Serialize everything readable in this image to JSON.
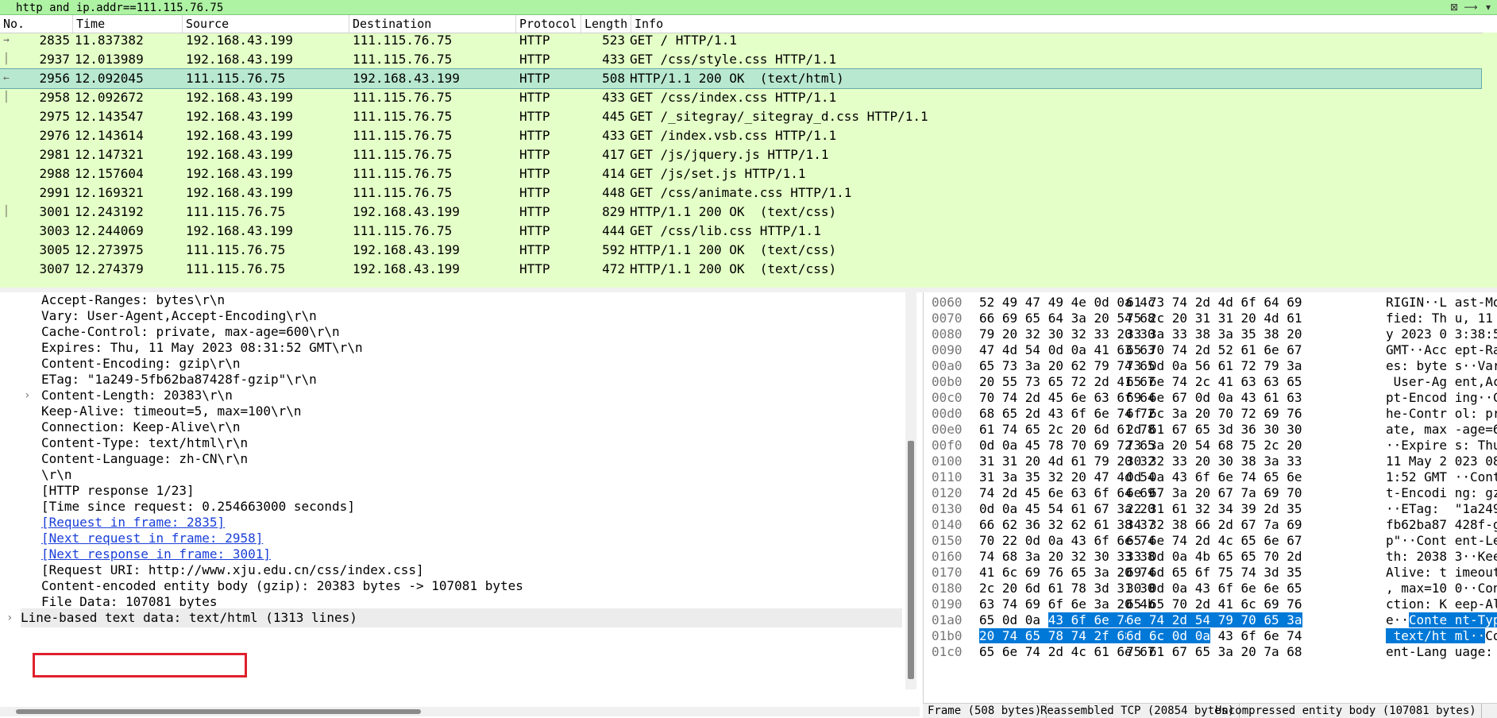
{
  "filter": {
    "value": "http and ip.addr==111.115.76.75",
    "clear_glyph": "⊠",
    "apply_glyph": "⟶",
    "dropdown_glyph": "▾"
  },
  "packet_list": {
    "columns": [
      "No.",
      "Time",
      "Source",
      "Destination",
      "Protocol",
      "Length",
      "Info"
    ],
    "rows": [
      {
        "rel": "→",
        "no": "2835",
        "time": "11.837382",
        "src": "192.168.43.199",
        "dst": "111.115.76.75",
        "proto": "HTTP",
        "len": "523",
        "info": "GET / HTTP/1.1",
        "selected": false
      },
      {
        "rel": "│",
        "no": "2937",
        "time": "12.013989",
        "src": "192.168.43.199",
        "dst": "111.115.76.75",
        "proto": "HTTP",
        "len": "433",
        "info": "GET /css/style.css HTTP/1.1",
        "selected": false
      },
      {
        "rel": "←",
        "no": "2956",
        "time": "12.092045",
        "src": "111.115.76.75",
        "dst": "192.168.43.199",
        "proto": "HTTP",
        "len": "508",
        "info": "HTTP/1.1 200 OK  (text/html)",
        "selected": true
      },
      {
        "rel": "│",
        "no": "2958",
        "time": "12.092672",
        "src": "192.168.43.199",
        "dst": "111.115.76.75",
        "proto": "HTTP",
        "len": "433",
        "info": "GET /css/index.css HTTP/1.1",
        "selected": false
      },
      {
        "rel": "",
        "no": "2975",
        "time": "12.143547",
        "src": "192.168.43.199",
        "dst": "111.115.76.75",
        "proto": "HTTP",
        "len": "445",
        "info": "GET /_sitegray/_sitegray_d.css HTTP/1.1",
        "selected": false
      },
      {
        "rel": "",
        "no": "2976",
        "time": "12.143614",
        "src": "192.168.43.199",
        "dst": "111.115.76.75",
        "proto": "HTTP",
        "len": "433",
        "info": "GET /index.vsb.css HTTP/1.1",
        "selected": false
      },
      {
        "rel": "",
        "no": "2981",
        "time": "12.147321",
        "src": "192.168.43.199",
        "dst": "111.115.76.75",
        "proto": "HTTP",
        "len": "417",
        "info": "GET /js/jquery.js HTTP/1.1",
        "selected": false
      },
      {
        "rel": "",
        "no": "2988",
        "time": "12.157604",
        "src": "192.168.43.199",
        "dst": "111.115.76.75",
        "proto": "HTTP",
        "len": "414",
        "info": "GET /js/set.js HTTP/1.1",
        "selected": false
      },
      {
        "rel": "",
        "no": "2991",
        "time": "12.169321",
        "src": "192.168.43.199",
        "dst": "111.115.76.75",
        "proto": "HTTP",
        "len": "448",
        "info": "GET /css/animate.css HTTP/1.1",
        "selected": false
      },
      {
        "rel": "│",
        "no": "3001",
        "time": "12.243192",
        "src": "111.115.76.75",
        "dst": "192.168.43.199",
        "proto": "HTTP",
        "len": "829",
        "info": "HTTP/1.1 200 OK  (text/css)",
        "selected": false
      },
      {
        "rel": "",
        "no": "3003",
        "time": "12.244069",
        "src": "192.168.43.199",
        "dst": "111.115.76.75",
        "proto": "HTTP",
        "len": "444",
        "info": "GET /css/lib.css HTTP/1.1",
        "selected": false
      },
      {
        "rel": "",
        "no": "3005",
        "time": "12.273975",
        "src": "111.115.76.75",
        "dst": "192.168.43.199",
        "proto": "HTTP",
        "len": "592",
        "info": "HTTP/1.1 200 OK  (text/css)",
        "selected": false
      },
      {
        "rel": "",
        "no": "3007",
        "time": "12.274379",
        "src": "111.115.76.75",
        "dst": "192.168.43.199",
        "proto": "HTTP",
        "len": "472",
        "info": "HTTP/1.1 200 OK  (text/css)",
        "selected": false
      }
    ]
  },
  "details": {
    "lines": [
      {
        "text": "Accept-Ranges: bytes\\r\\n",
        "link": false
      },
      {
        "text": "Vary: User-Agent,Accept-Encoding\\r\\n",
        "link": false
      },
      {
        "text": "Cache-Control: private, max-age=600\\r\\n",
        "link": false
      },
      {
        "text": "Expires: Thu, 11 May 2023 08:31:52 GMT\\r\\n",
        "link": false
      },
      {
        "text": "Content-Encoding: gzip\\r\\n",
        "link": false
      },
      {
        "text": "ETag: \"1a249-5fb62ba87428f-gzip\"\\r\\n",
        "link": false
      },
      {
        "text": "Content-Length: 20383\\r\\n",
        "link": false,
        "expander": "›"
      },
      {
        "text": "Keep-Alive: timeout=5, max=100\\r\\n",
        "link": false
      },
      {
        "text": "Connection: Keep-Alive\\r\\n",
        "link": false
      },
      {
        "text": "Content-Type: text/html\\r\\n",
        "link": false
      },
      {
        "text": "Content-Language: zh-CN\\r\\n",
        "link": false
      },
      {
        "text": "\\r\\n",
        "link": false
      },
      {
        "text": "[HTTP response 1/23]",
        "link": false
      },
      {
        "text": "[Time since request: 0.254663000 seconds]",
        "link": false
      },
      {
        "text": "[Request in frame: 2835]",
        "link": true
      },
      {
        "text": "[Next request in frame: 2958]",
        "link": true
      },
      {
        "text": "[Next response in frame: 3001]",
        "link": true
      },
      {
        "text": "[Request URI: http://www.xju.edu.cn/css/index.css]",
        "link": false
      },
      {
        "text": "Content-encoded entity body (gzip): 20383 bytes -> 107081 bytes",
        "link": false
      },
      {
        "text": "File Data: 107081 bytes",
        "link": false
      }
    ],
    "last_line": {
      "text": "Line-based text data: text/html (1313 lines)",
      "expander": "›"
    }
  },
  "bytes": {
    "rows": [
      {
        "off": "0060",
        "h1": "52 49 47 49 4e 0d 0a 4c",
        "h2": "61 73 74 2d 4d 6f 64 69",
        "ascii": "RIGIN··L ast-Modi"
      },
      {
        "off": "0070",
        "h1": "66 69 65 64 3a 20 54 68",
        "h2": "75 2c 20 31 31 20 4d 61",
        "ascii": "fied: Th u, 11 Ma"
      },
      {
        "off": "0080",
        "h1": "79 20 32 30 32 33 20 30",
        "h2": "33 3a 33 38 3a 35 38 20",
        "ascii": "y 2023 0 3:38:58 "
      },
      {
        "off": "0090",
        "h1": "47 4d 54 0d 0a 41 63 63",
        "h2": "65 70 74 2d 52 61 6e 67",
        "ascii": "GMT··Acc ept-Rang"
      },
      {
        "off": "00a0",
        "h1": "65 73 3a 20 62 79 74 65",
        "h2": "73 0d 0a 56 61 72 79 3a",
        "ascii": "es: byte s··Vary:"
      },
      {
        "off": "00b0",
        "h1": "20 55 73 65 72 2d 41 67",
        "h2": "65 6e 74 2c 41 63 63 65",
        "ascii": " User-Ag ent,Acce"
      },
      {
        "off": "00c0",
        "h1": "70 74 2d 45 6e 63 6f 64",
        "h2": "69 6e 67 0d 0a 43 61 63",
        "ascii": "pt-Encod ing··Cac"
      },
      {
        "off": "00d0",
        "h1": "68 65 2d 43 6f 6e 74 72",
        "h2": "6f 6c 3a 20 70 72 69 76",
        "ascii": "he-Contr ol: priv"
      },
      {
        "off": "00e0",
        "h1": "61 74 65 2c 20 6d 61 78",
        "h2": "2d 61 67 65 3d 36 30 30",
        "ascii": "ate, max -age=600"
      },
      {
        "off": "00f0",
        "h1": "0d 0a 45 78 70 69 72 65",
        "h2": "73 3a 20 54 68 75 2c 20",
        "ascii": "··Expire s: Thu, "
      },
      {
        "off": "0100",
        "h1": "31 31 20 4d 61 79 20 32",
        "h2": "30 32 33 20 30 38 3a 33",
        "ascii": "11 May 2 023 08:3"
      },
      {
        "off": "0110",
        "h1": "31 3a 35 32 20 47 4d 54",
        "h2": "0d 0a 43 6f 6e 74 65 6e",
        "ascii": "1:52 GMT ··Conten"
      },
      {
        "off": "0120",
        "h1": "74 2d 45 6e 63 6f 64 69",
        "h2": "6e 67 3a 20 67 7a 69 70",
        "ascii": "t-Encodi ng: gzip"
      },
      {
        "off": "0130",
        "h1": "0d 0a 45 54 61 67 3a 20",
        "h2": "22 31 61 32 34 39 2d 35",
        "ascii": "··ETag:  \"1a249-5"
      },
      {
        "off": "0140",
        "h1": "66 62 36 32 62 61 38 37",
        "h2": "34 32 38 66 2d 67 7a 69",
        "ascii": "fb62ba87 428f-gzi"
      },
      {
        "off": "0150",
        "h1": "70 22 0d 0a 43 6f 6e 74",
        "h2": "65 6e 74 2d 4c 65 6e 67",
        "ascii": "p\"··Cont ent-Leng"
      },
      {
        "off": "0160",
        "h1": "74 68 3a 20 32 30 33 38",
        "h2": "33 0d 0a 4b 65 65 70 2d",
        "ascii": "th: 2038 3··Keep-"
      },
      {
        "off": "0170",
        "h1": "41 6c 69 76 65 3a 20 74",
        "h2": "69 6d 65 6f 75 74 3d 35",
        "ascii": "Alive: t imeout=5"
      },
      {
        "off": "0180",
        "h1": "2c 20 6d 61 78 3d 31 30",
        "h2": "30 0d 0a 43 6f 6e 6e 65",
        "ascii": ", max=10 0··Conne"
      },
      {
        "off": "0190",
        "h1": "63 74 69 6f 6e 3a 20 4b",
        "h2": "65 65 70 2d 41 6c 69 76",
        "ascii": "ction: K eep-Aliv"
      },
      {
        "off": "01a0",
        "h1": "65 0d 0a ",
        "h1hl": "43 6f 6e 74 65",
        "h2": "",
        "h2hl": "6e 74 2d 54 79 70 65 3a",
        "ascii": "e··",
        "asciihl": "Conte nt-Type:"
      },
      {
        "off": "01b0",
        "h1": "",
        "h1hl": "20 74 65 78 74 2f 68 74",
        "h2": " 43 6f 6e 74",
        "h2hl": "6d 6c 0d 0a",
        "ascii": "",
        "asciihl": " text/ht ml··",
        "ascii2": "Cont"
      },
      {
        "off": "01c0",
        "h1": "65 6e 74 2d 4c 61 6e 67",
        "h2": "75 61 67 65 3a 20 7a 68",
        "ascii": "ent-Lang uage: zh"
      }
    ]
  },
  "status_tabs": [
    "Frame (508 bytes)",
    "Reassembled TCP (20854 bytes)",
    "Uncompressed entity body (107081 bytes)"
  ]
}
